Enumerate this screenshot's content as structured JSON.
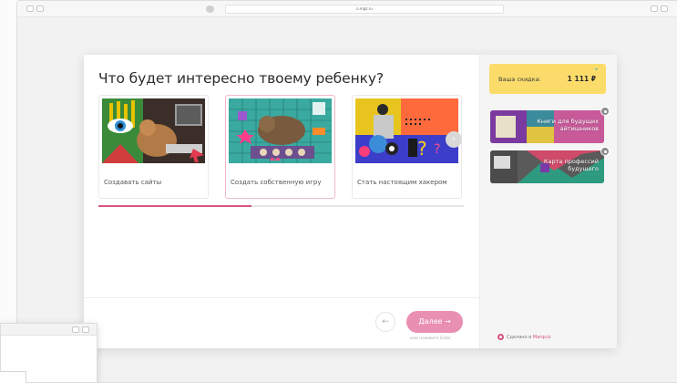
{
  "browser": {
    "url": "o.mqz.ru"
  },
  "quiz": {
    "question": "Что будет интересно твоему ребенку?",
    "options": [
      {
        "label": "Создавать сайты",
        "selected": false
      },
      {
        "label": "Создать собственную игру",
        "selected": true
      },
      {
        "label": "Стать настоящим хакером",
        "selected": false
      }
    ],
    "progress_percent": 42,
    "next_label": "Далее →",
    "back_icon": "arrow-left-icon",
    "enter_hint": "или нажмите Enter"
  },
  "sidebar": {
    "discount_label": "Ваша скидка:",
    "discount_value": "1 111 ₽",
    "bonuses": [
      {
        "label": "Книги для будущих айтишников"
      },
      {
        "label": "Карта профессий будущего"
      }
    ],
    "made_with_prefix": "Сделано в ",
    "made_with_brand": "Marquiz"
  },
  "colors": {
    "accent": "#d9547f",
    "button": "#e98fb1",
    "discount_bg": "#fbdc6b"
  }
}
